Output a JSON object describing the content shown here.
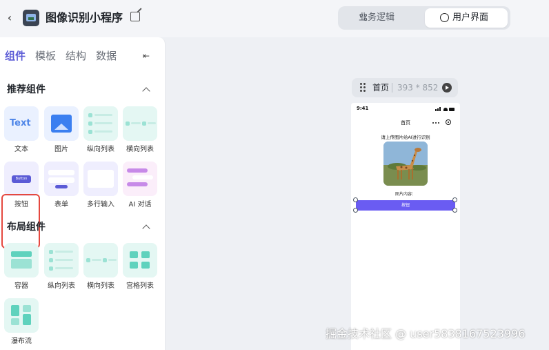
{
  "header": {
    "app_title": "图像识别小程序",
    "mode_tabs": [
      {
        "label": "业务逻辑",
        "active": false
      },
      {
        "label": "用户界面",
        "active": true
      }
    ]
  },
  "panel": {
    "tabs": [
      "组件",
      "模板",
      "结构",
      "数据"
    ],
    "active_tab": "组件",
    "sections": [
      {
        "title": "推荐组件",
        "items": [
          {
            "label": "文本",
            "art_text": "Text"
          },
          {
            "label": "图片"
          },
          {
            "label": "纵向列表"
          },
          {
            "label": "横向列表"
          },
          {
            "label": "按钮",
            "art_text": "Button",
            "selected": true
          },
          {
            "label": "表单"
          },
          {
            "label": "多行输入"
          },
          {
            "label": "AI 对话"
          }
        ]
      },
      {
        "title": "布局组件",
        "items": [
          {
            "label": "容器"
          },
          {
            "label": "纵向列表"
          },
          {
            "label": "横向列表"
          },
          {
            "label": "宫格列表"
          },
          {
            "label": "瀑布流"
          }
        ]
      }
    ]
  },
  "canvas": {
    "page_name": "首页",
    "page_size": "393 * 852",
    "phone": {
      "time": "9:41",
      "nav_title": "首页",
      "prompt": "请上传图片给AI进行识别",
      "result_label": "图片内容：",
      "button_label": "按钮"
    }
  },
  "watermark": "掘金技术社区 @ user5838167523996",
  "colors": {
    "accent": "#5b5bd6",
    "selection": "#e5483f",
    "phone_button": "#6a5cf2"
  }
}
